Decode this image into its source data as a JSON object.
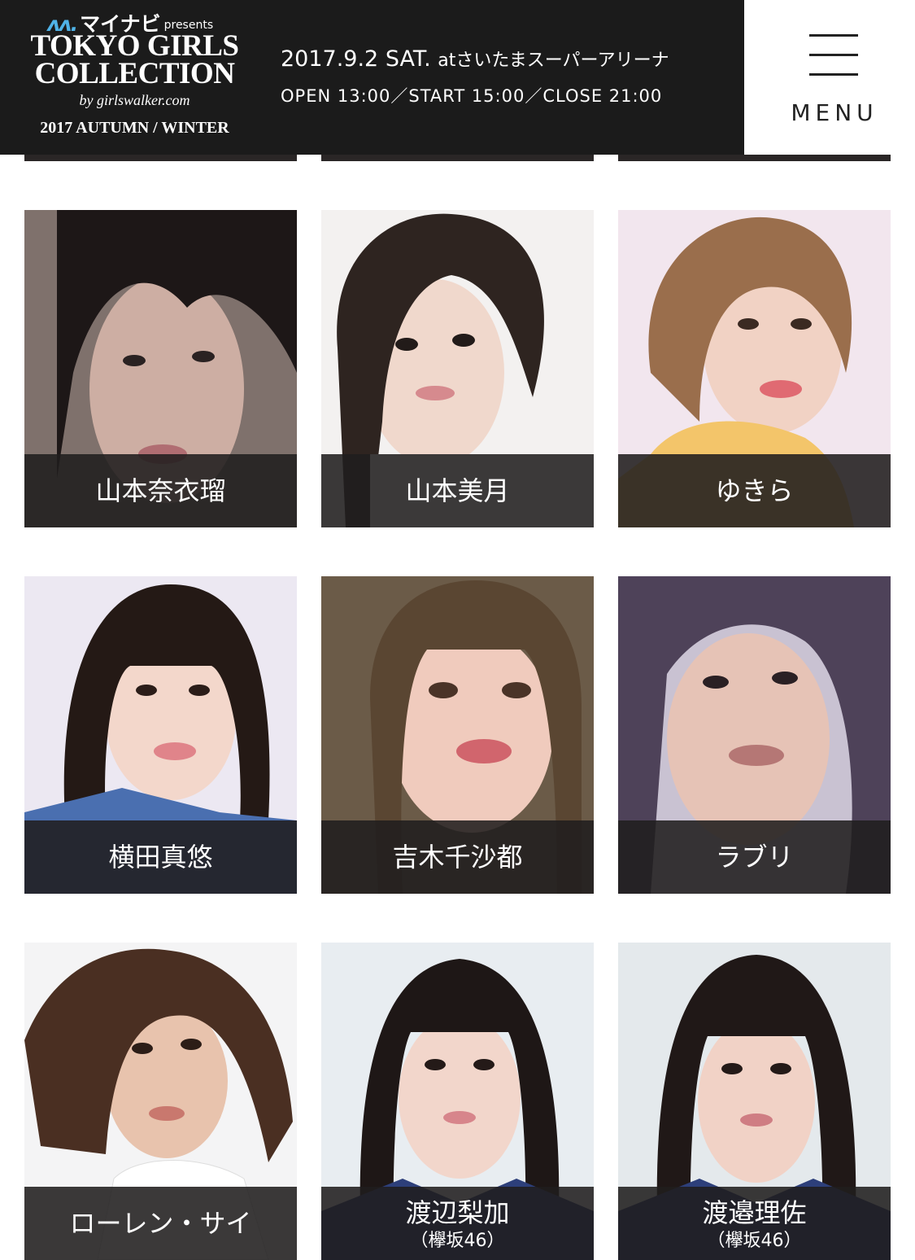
{
  "header": {
    "sponsor": "マイナビ",
    "presents": "presents",
    "brand_line1": "TOKYO GIRLS",
    "brand_line2": "COLLECTION",
    "byline": "by girlswalker.com",
    "season": "2017 AUTUMN / WINTER",
    "date": "2017.9.2 SAT.",
    "at": "at",
    "venue": "さいたまスーパーアリーナ",
    "times": "OPEN 13:00／START 15:00／CLOSE 21:00",
    "menu_label": "MENU"
  },
  "models": [
    {
      "name": "山本奈衣瑠",
      "group": ""
    },
    {
      "name": "山本美月",
      "group": ""
    },
    {
      "name": "ゆきら",
      "group": ""
    },
    {
      "name": "横田真悠",
      "group": ""
    },
    {
      "name": "吉木千沙都",
      "group": ""
    },
    {
      "name": "ラブリ",
      "group": ""
    },
    {
      "name": "ローレン・サイ",
      "group": ""
    },
    {
      "name": "渡辺梨加",
      "group": "（欅坂46）"
    },
    {
      "name": "渡邉理佐",
      "group": "（欅坂46）"
    }
  ],
  "colors": {
    "header_bg": "#1b1b1b",
    "caption_bg": "#201e1e",
    "accent": "#4fb3e8"
  }
}
